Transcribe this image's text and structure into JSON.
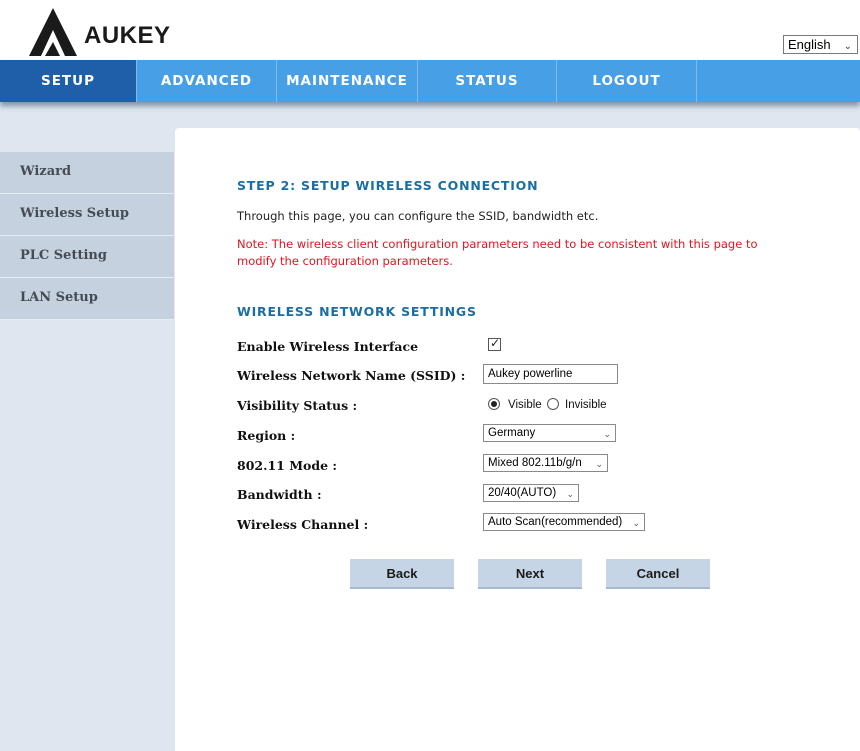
{
  "header": {
    "brand": "AUKEY",
    "language": "English"
  },
  "nav": {
    "items": [
      {
        "label": "SETUP",
        "active": true
      },
      {
        "label": "ADVANCED",
        "active": false
      },
      {
        "label": "MAINTENANCE",
        "active": false
      },
      {
        "label": "STATUS",
        "active": false
      },
      {
        "label": "LOGOUT",
        "active": false
      }
    ]
  },
  "sidebar": {
    "items": [
      {
        "label": "Wizard"
      },
      {
        "label": "Wireless Setup"
      },
      {
        "label": "PLC Setting"
      },
      {
        "label": "LAN Setup"
      }
    ]
  },
  "main": {
    "step_title": "STEP 2: SETUP WIRELESS CONNECTION",
    "intro": "Through this page, you can configure the SSID, bandwidth etc.",
    "note": "Note: The wireless client configuration parameters need to be consistent with this page to modify the configuration parameters.",
    "section_title": "WIRELESS NETWORK SETTINGS",
    "fields": {
      "enable_wireless": {
        "label": "Enable Wireless Interface",
        "checked": true
      },
      "ssid": {
        "label": "Wireless Network Name (SSID) :",
        "value": "Aukey powerline"
      },
      "visibility": {
        "label": "Visibility Status :",
        "options": [
          "Visible",
          "Invisible"
        ],
        "selected": "Visible"
      },
      "region": {
        "label": "Region :",
        "value": "Germany"
      },
      "mode": {
        "label": "802.11 Mode :",
        "value": "Mixed 802.11b/g/n"
      },
      "bandwidth": {
        "label": "Bandwidth :",
        "value": "20/40(AUTO)"
      },
      "channel": {
        "label": "Wireless Channel :",
        "value": "Auto Scan(recommended)"
      }
    },
    "buttons": {
      "back": "Back",
      "next": "Next",
      "cancel": "Cancel"
    }
  },
  "colors": {
    "nav_bg": "#47a0e6",
    "nav_active": "#1f5ea8",
    "title_blue": "#1b6ea3",
    "note_red": "#e0161e",
    "sidebar_bg": "#c5d1df"
  }
}
